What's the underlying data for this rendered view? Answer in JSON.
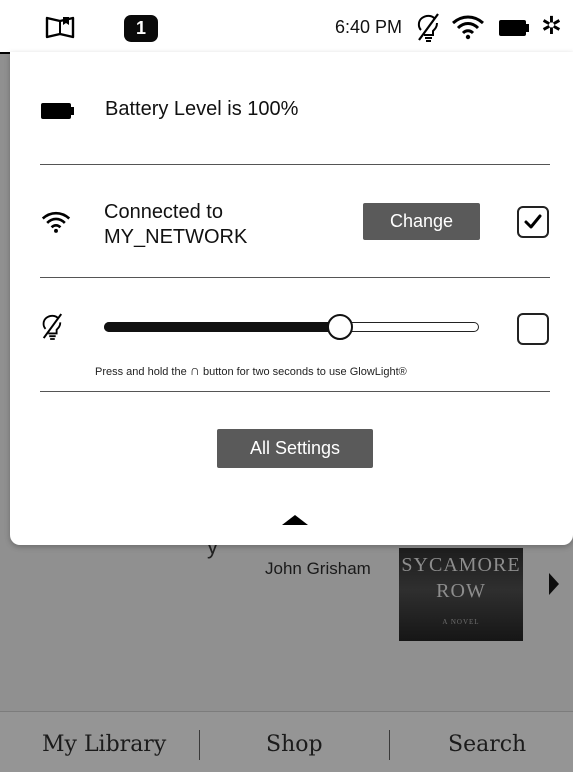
{
  "status_bar": {
    "badge_count": "1",
    "time": "6:40 PM",
    "icons": [
      "book-icon",
      "glowlight-off-icon",
      "wifi-icon",
      "battery-icon",
      "gear-icon"
    ]
  },
  "quick_settings": {
    "battery_text": "Battery Level is 100%",
    "wifi": {
      "line1": "Connected to",
      "network": "MY_NETWORK",
      "change_label": "Change",
      "enabled": true
    },
    "glowlight": {
      "level": 0.63,
      "enabled": false,
      "hint_before": "Press and hold the ",
      "hint_symbol": "∩",
      "hint_after": " button for two seconds to use GlowLight®"
    },
    "all_settings_label": "All Settings"
  },
  "background": {
    "author": "John Grisham",
    "cover_title_line1": "SYCAMORE",
    "cover_title_line2": "ROW",
    "cover_sub": "A NOVEL",
    "partial_text": "y"
  },
  "bottom_nav": {
    "items": [
      "My Library",
      "Shop",
      "Search"
    ]
  },
  "colors": {
    "button_bg": "#5a5a5a",
    "overlay_bg": "#909090",
    "panel_bg": "#ffffff"
  }
}
